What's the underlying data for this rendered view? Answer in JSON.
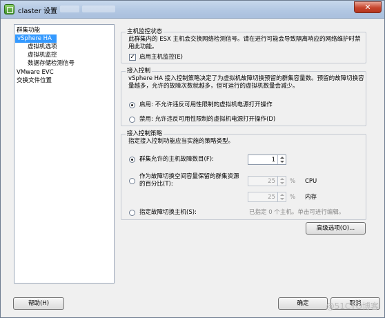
{
  "window": {
    "title": "claster 设置",
    "close_label": "✕"
  },
  "nav": {
    "items": [
      {
        "label": "群集功能"
      },
      {
        "label": "vSphere HA"
      },
      {
        "label": "虚拟机选项"
      },
      {
        "label": "虚拟机监控"
      },
      {
        "label": "数据存储检测信号"
      },
      {
        "label": "VMware EVC"
      },
      {
        "label": "交换文件位置"
      }
    ]
  },
  "host_monitoring": {
    "title": "主机监控状态",
    "description": "此群集内的 ESX 主机会交换网络检测信号。请在进行可能会导致隔离响应的网络维护时禁用此功能。",
    "checkbox_label": "启用主机监控(E)",
    "checked": true
  },
  "admission_control": {
    "title": "接入控制",
    "description": "vSphere HA 接入控制策略决定了为虚拟机故障切换预留的群集容量数。预留的故障切换容量越多，允许的故障次数就越多，但可运行的虚拟机数量会减少。",
    "enable_label": "启用: 不允许违反可用性限制的虚拟机电源打开操作",
    "disable_label": "禁用: 允许违反可用性限制的虚拟机电源打开操作(D)",
    "selected": "enable"
  },
  "admission_policy": {
    "title": "接入控制策略",
    "description": "指定接入控制功能应当实施的策略类型。",
    "host_failures_label": "群集允许的主机故障数目(F):",
    "host_failures_value": "1",
    "percentage_label": "作为故障切换空间容量保留的群集资源的百分比(T):",
    "cpu_value": "25",
    "cpu_unit": "%",
    "cpu_label": "CPU",
    "memory_value": "25",
    "memory_unit": "%",
    "memory_label": "内存",
    "failover_hosts_label": "指定故障切换主机(S):",
    "failover_hosts_status": "已指定 0 个主机。单击可进行编辑。",
    "selected": "host_failures"
  },
  "buttons": {
    "advanced": "高级选项(O)...",
    "help": "帮助(H)",
    "ok": "确定",
    "cancel": "取消"
  },
  "watermark": "@51CTO博客"
}
